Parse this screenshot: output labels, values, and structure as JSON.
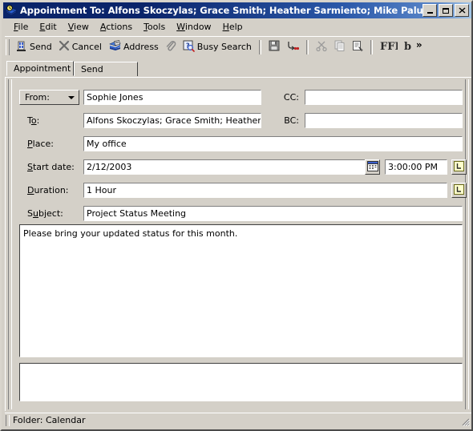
{
  "window": {
    "title": "Appointment To: Alfons Skoczylas; Grace Smith; Heather Sarmiento; Mike Palu; S",
    "icon": "appointment-book-clock-icon",
    "minimize_label": "Minimize",
    "maximize_label": "Maximize",
    "close_label": "Close"
  },
  "menubar": {
    "items": [
      {
        "label": "File",
        "accel": "F"
      },
      {
        "label": "Edit",
        "accel": "E"
      },
      {
        "label": "View",
        "accel": "V"
      },
      {
        "label": "Actions",
        "accel": "A"
      },
      {
        "label": "Tools",
        "accel": "T"
      },
      {
        "label": "Window",
        "accel": "W"
      },
      {
        "label": "Help",
        "accel": "H"
      }
    ]
  },
  "toolbar": {
    "send_label": "Send",
    "cancel_label": "Cancel",
    "address_label": "Address",
    "busy_search_label": "Busy Search",
    "attach_icon": "paperclip-icon",
    "save_icon": "floppy-disk-icon",
    "send_later_icon": "send-options-icon",
    "cut_icon": "scissors-icon",
    "copy_icon": "copy-icon",
    "paste_icon": "paste-icon",
    "font_icon": "font-icon",
    "bold_icon": "bold-icon",
    "overflow_label": "»"
  },
  "tabs": [
    {
      "label": "Appointment",
      "active": true
    },
    {
      "label": "Send Options",
      "active": false
    }
  ],
  "form": {
    "from": {
      "label": "From:",
      "dropdown_icon": "chevron-down-icon",
      "value": "Sophie Jones"
    },
    "to": {
      "label": "To:",
      "accel": "o",
      "value": "Alfons Skoczylas; Grace Smith; Heather(...)"
    },
    "cc": {
      "label": "CC:",
      "value": ""
    },
    "bc": {
      "label": "BC:",
      "value": ""
    },
    "place": {
      "label": "Place:",
      "accel": "P",
      "value": "My office"
    },
    "start_date": {
      "label": "Start date:",
      "accel": "S",
      "value": "2/12/2003",
      "calendar_icon": "calendar-icon",
      "time_value": "3:00:00 PM",
      "time_icon": "clock-icon"
    },
    "duration": {
      "label": "Duration:",
      "accel": "D",
      "value": "1 Hour",
      "duration_icon": "clock-icon"
    },
    "subject": {
      "label": "Subject:",
      "accel": "b",
      "value": "Project Status Meeting"
    },
    "message_body": "Please bring your updated status for this month.",
    "attachments": ""
  },
  "statusbar": {
    "text": "Folder: Calendar",
    "resize_grip": "resize-grip-icon"
  },
  "colors": {
    "face": "#d4d0c8",
    "title_start": "#0a246a",
    "title_end": "#a6c8e8",
    "field_bg": "#ffffff",
    "icon_yellow": "#ffffcc",
    "accent_blue": "#3a5fcd"
  }
}
